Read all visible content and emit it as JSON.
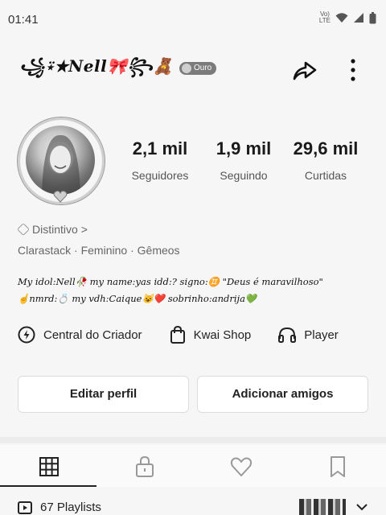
{
  "status_bar": {
    "time": "01:41",
    "network": "LTE"
  },
  "profile": {
    "display_name": "꧁⍣★Nell🎀꧂🧸",
    "rank_label": "Ouro"
  },
  "stats": [
    {
      "value": "2,1 mil",
      "label": "Seguidores"
    },
    {
      "value": "1,9 mil",
      "label": "Seguindo"
    },
    {
      "value": "29,6 mil",
      "label": "Curtidas"
    }
  ],
  "badge": {
    "label": "Distintivo",
    "chevron": ">"
  },
  "meta": {
    "username": "Clarastack",
    "gender": "Feminino",
    "sign": "Gêmeos",
    "separator": "·"
  },
  "bio": {
    "line1": "My idol:Nell🥀 my name:yas idd:? signo:♊ \"Deus é maravilhoso\"",
    "line2": "☝️nmrd:💍 my vdh:Caique😺❤️ sobrinho:andrija💚"
  },
  "shortcuts": [
    {
      "label": "Central do Criador",
      "icon": "lightning-circle-icon"
    },
    {
      "label": "Kwai Shop",
      "icon": "shopping-bag-icon"
    },
    {
      "label": "Player",
      "icon": "headphones-icon"
    }
  ],
  "buttons": {
    "edit": "Editar perfil",
    "add_friends": "Adicionar amigos"
  },
  "tabs": [
    {
      "icon": "grid-icon",
      "selected": true
    },
    {
      "icon": "lock-icon",
      "selected": false
    },
    {
      "icon": "heart-icon",
      "selected": false
    },
    {
      "icon": "bookmark-icon",
      "selected": false
    }
  ],
  "playlists": {
    "label": "67 Playlists"
  }
}
